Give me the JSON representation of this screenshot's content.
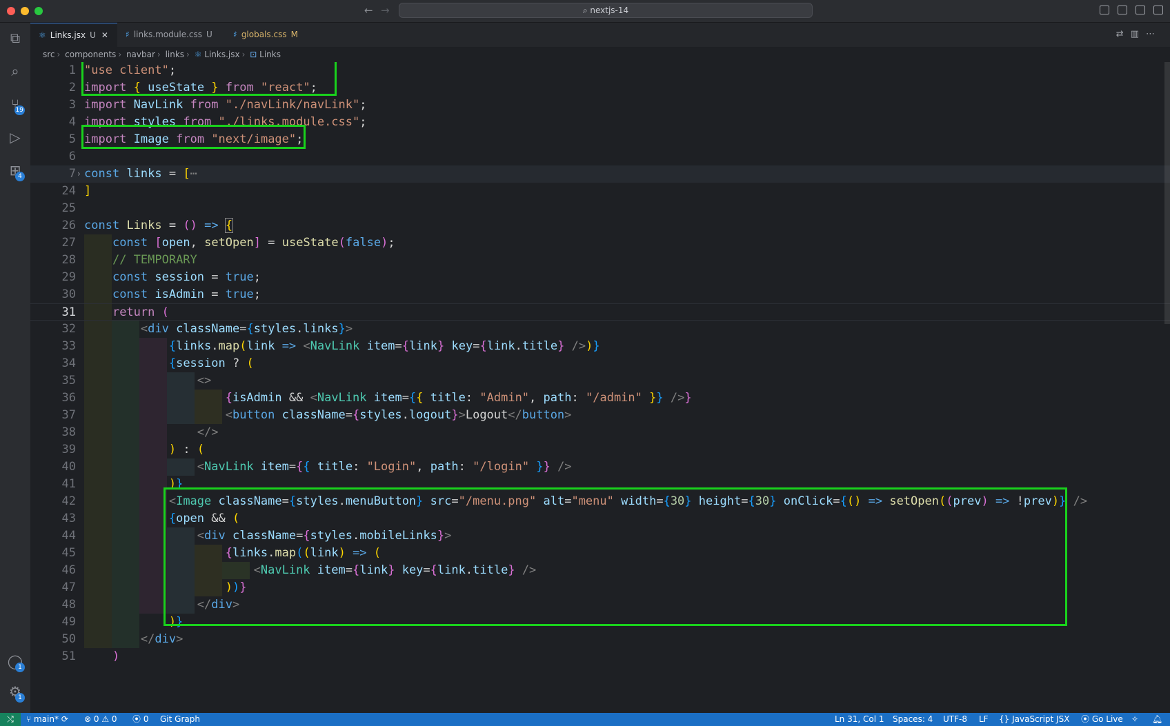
{
  "window": {
    "search_text": "nextjs-14",
    "search_icon": "search-icon"
  },
  "activity_bar": {
    "source_control_badge": "19",
    "extensions_badge": "4",
    "accounts_badge": "1",
    "settings_badge": "1"
  },
  "tabs": [
    {
      "label": "Links.jsx",
      "status": "U",
      "icon": "react-icon",
      "active": true
    },
    {
      "label": "links.module.css",
      "status": "U",
      "icon": "css-icon",
      "active": false
    },
    {
      "label": "globals.css",
      "status": "M",
      "icon": "css-icon",
      "active": false
    }
  ],
  "breadcrumb": [
    "src",
    "components",
    "navbar",
    "links",
    "Links.jsx",
    "Links"
  ],
  "editor": {
    "line_numbers": [
      "1",
      "2",
      "3",
      "4",
      "5",
      "6",
      "7",
      "24",
      "25",
      "26",
      "27",
      "28",
      "29",
      "30",
      "31",
      "32",
      "33",
      "34",
      "35",
      "36",
      "37",
      "38",
      "39",
      "40",
      "41",
      "42",
      "43",
      "44",
      "45",
      "46",
      "47",
      "48",
      "49",
      "50",
      "51"
    ],
    "current_line": "31"
  },
  "status_bar": {
    "branch": "main*",
    "errors": "0",
    "warnings": "0",
    "ports": "0",
    "git_graph": "Git Graph",
    "cursor": "Ln 31, Col 1",
    "spaces": "Spaces: 4",
    "encoding": "UTF-8",
    "eol": "LF",
    "language": "JavaScript JSX",
    "go_live": "Go Live"
  },
  "colors": {
    "highlight_box": "#19d11c",
    "status_bar": "#1b6fc5"
  }
}
